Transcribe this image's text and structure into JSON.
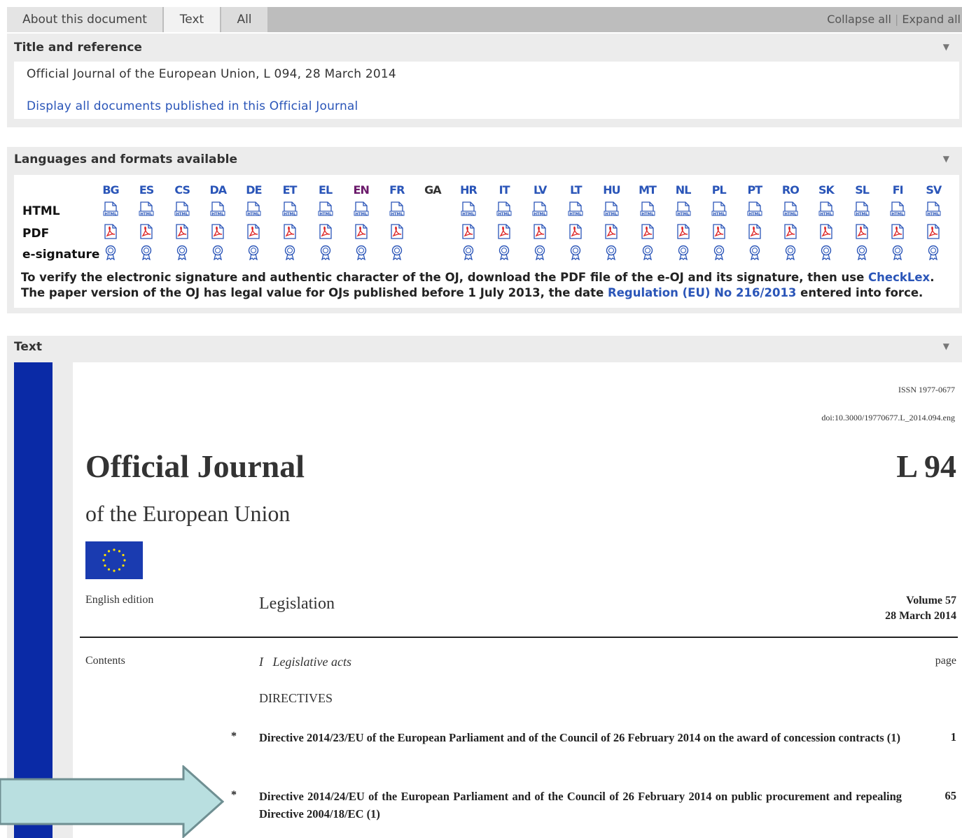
{
  "tabs": {
    "about": "About this document",
    "text": "Text",
    "all": "All"
  },
  "toolbar": {
    "collapse_all": "Collapse all",
    "expand_all": "Expand all"
  },
  "title_section": {
    "heading": "Title and reference",
    "reference": "Official Journal of the European Union, L 094, 28 March 2014",
    "display_link": "Display all documents published in this Official Journal"
  },
  "languages_section": {
    "heading": "Languages and formats available",
    "row_labels": {
      "html": "HTML",
      "pdf": "PDF",
      "esig": "e-signature"
    },
    "languages": [
      "BG",
      "ES",
      "CS",
      "DA",
      "DE",
      "ET",
      "EL",
      "EN",
      "FR",
      "GA",
      "HR",
      "IT",
      "LV",
      "LT",
      "HU",
      "MT",
      "NL",
      "PL",
      "PT",
      "RO",
      "SK",
      "SL",
      "FI",
      "SV"
    ],
    "active_language": "EN",
    "unavailable_language": "GA",
    "note_part1": "To verify the electronic signature and authentic character of the OJ, download the PDF file of the e-OJ and its signature, then use ",
    "checklex_link": "CheckLex",
    "note_part2": ". The paper version of the OJ has legal value for OJs published before 1 July 2013, the date ",
    "regulation_link": "Regulation (EU) No 216/2013",
    "note_part3": " entered into force."
  },
  "text_section": {
    "heading": "Text",
    "issn": "ISSN 1977-0677",
    "doi": "doi:10.3000/19770677.L_2014.094.eng",
    "journal_title": "Official Journal",
    "journal_number": "L 94",
    "journal_subtitle": "of the European Union",
    "edition": "English edition",
    "category": "Legislation",
    "volume": "Volume 57",
    "date": "28 March 2014",
    "contents_label": "Contents",
    "section_i": "I   Legislative acts",
    "page_label": "page",
    "directives_heading": "DIRECTIVES",
    "items": [
      {
        "star": "*",
        "text": "Directive 2014/23/EU of the European Parliament and of the Council of 26 February 2014 on the award of concession contracts (1)",
        "page": "1"
      },
      {
        "star": "*",
        "text": "Directive 2014/24/EU of the European Parliament and of the Council of 26 February 2014 on public procurement and repealing Directive 2004/18/EC (1)",
        "page": "65"
      }
    ]
  },
  "colors": {
    "link": "#2a55b8",
    "eu_blue": "#0a2aa6",
    "arrow_fill": "#b9dfe0",
    "arrow_stroke": "#6f8f92"
  }
}
